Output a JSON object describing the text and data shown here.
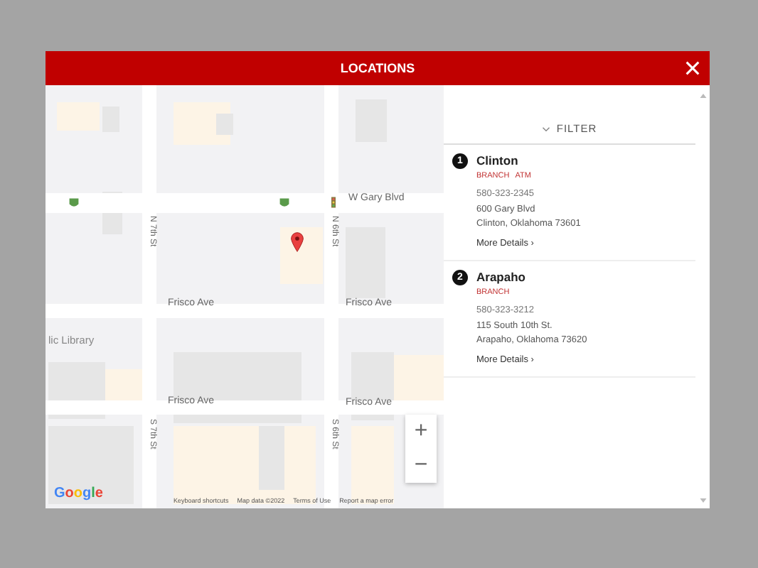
{
  "dialog": {
    "title": "LOCATIONS"
  },
  "map": {
    "streets": [
      {
        "label": "W Gary Blvd",
        "kind": "h"
      },
      {
        "label": "N 7th St",
        "kind": "v"
      },
      {
        "label": "N 6th St",
        "kind": "v"
      },
      {
        "label": "Frisco Ave",
        "kind": "h"
      },
      {
        "label": "Frisco Ave",
        "kind": "h"
      },
      {
        "label": "lic Library",
        "kind": "poi"
      },
      {
        "label": "Frisco Ave",
        "kind": "h"
      },
      {
        "label": "Frisco Ave",
        "kind": "h"
      },
      {
        "label": "S 7th St",
        "kind": "v"
      },
      {
        "label": "S 6th St",
        "kind": "v"
      }
    ],
    "logo": "Google",
    "footer": [
      "Keyboard shortcuts",
      "Map data ©2022",
      "Terms of Use",
      "Report a map error"
    ],
    "zoom": [
      "+",
      "−"
    ]
  },
  "filter": {
    "label": "FILTER"
  },
  "locations": [
    {
      "number": "1",
      "name": "Clinton",
      "tags": [
        "BRANCH",
        "ATM"
      ],
      "phone": "580-323-2345",
      "address": [
        "600 Gary Blvd",
        "Clinton, Oklahoma 73601"
      ],
      "link": "More Details ›"
    },
    {
      "number": "2",
      "name": "Arapaho",
      "tags": [
        "BRANCH"
      ],
      "phone": "580-323-3212",
      "address": [
        "115 South 10th St.",
        "Arapaho, Oklahoma 73620"
      ],
      "link": "More Details ›"
    }
  ]
}
